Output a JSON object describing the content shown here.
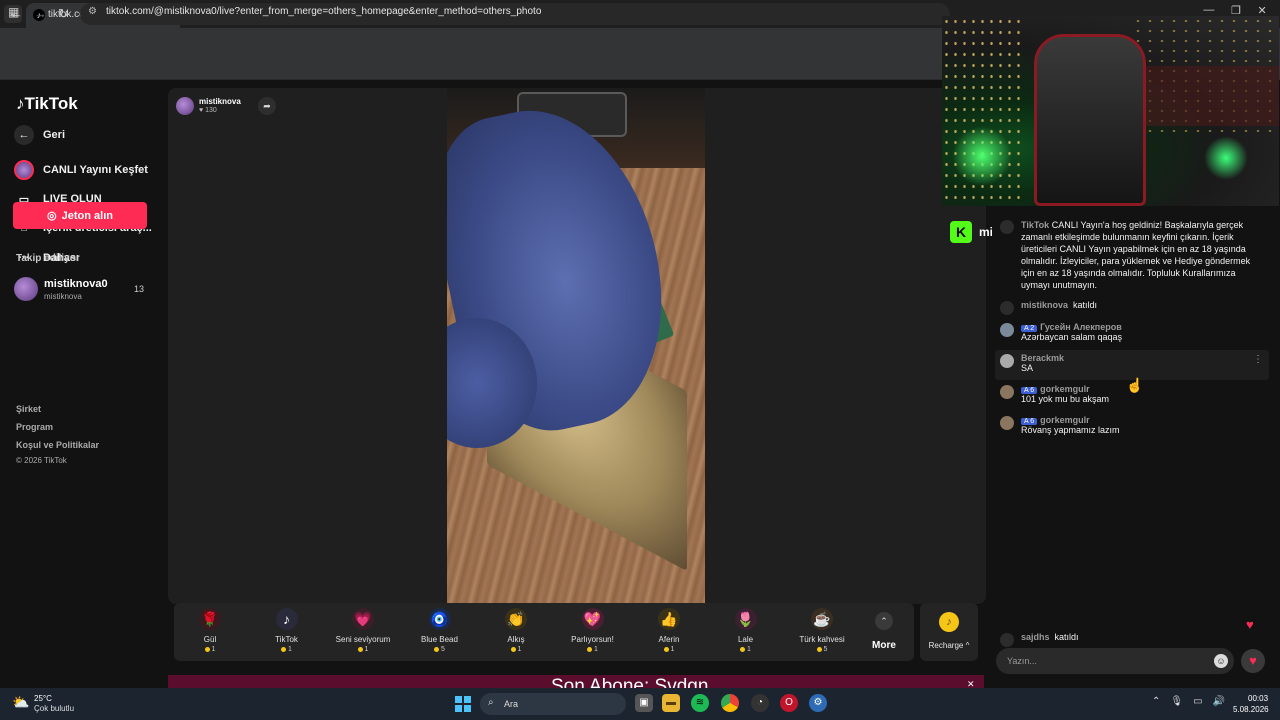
{
  "browser": {
    "tab_title": "tiktok.com/@mistiknova0/li",
    "url": "tiktok.com/@mistiknova0/live?enter_from_merge=others_homepage&enter_method=others_photo"
  },
  "sidebar": {
    "logo": "TikTok",
    "back_label": "Geri",
    "items": [
      {
        "label": "CANLI Yayını Keşfet"
      },
      {
        "label": "LIVE OLUN"
      },
      {
        "label": "İçerik üreticisi araç..."
      },
      {
        "label": "Dahası"
      }
    ],
    "coin_button": "Jeton alın",
    "following_title": "Takip ediliyor",
    "following": {
      "name": "mistiknova0",
      "handle": "mistiknova",
      "count": "13"
    },
    "footer": [
      "Şirket",
      "Program",
      "Koşul ve Politikalar",
      "© 2026 TikTok"
    ]
  },
  "stream": {
    "host_name": "mistiknova",
    "host_likes": "130",
    "kick_name": "mistiknova",
    "banner": "Son Abone: Svdgn"
  },
  "gifts": [
    {
      "name": "Gül",
      "price": "1",
      "icon": "rose-icon",
      "glyph": "🌹"
    },
    {
      "name": "TikTok",
      "price": "1",
      "icon": "tiktok-gift-icon",
      "glyph": "♪"
    },
    {
      "name": "Seni seviyorum",
      "price": "1",
      "icon": "love-icon",
      "glyph": "💗"
    },
    {
      "name": "Blue Bead",
      "price": "5",
      "icon": "blue-bead-icon",
      "glyph": "🧿"
    },
    {
      "name": "Alkış",
      "price": "1",
      "icon": "clap-icon",
      "glyph": "👏"
    },
    {
      "name": "Parlıyorsun!",
      "price": "1",
      "icon": "shine-heart-icon",
      "glyph": "💖"
    },
    {
      "name": "Aferin",
      "price": "1",
      "icon": "thumbs-up-icon",
      "glyph": "👍"
    },
    {
      "name": "Lale",
      "price": "1",
      "icon": "tulip-icon",
      "glyph": "🌷"
    },
    {
      "name": "Türk kahvesi",
      "price": "5",
      "icon": "coffee-icon",
      "glyph": "☕"
    }
  ],
  "gift_more_label": "More",
  "recharge_label": "Recharge ^",
  "chat": {
    "welcome_user": "TikTok",
    "welcome_text": "CANLI Yayın'a hoş geldiniz! Başkalarıyla gerçek zamanlı etkileşimde bulunmanın keyfini çıkarın. İçerik üreticileri CANLI Yayın yapabilmek için en az 18 yaşında olmalıdır. İzleyiciler, para yüklemek ve Hediye göndermek için en az 18 yaşında olmalıdır. Topluluk Kurallarımıza uymayı unutmayın.",
    "join1_user": "mistiknova",
    "join_text": "katıldı",
    "messages": [
      {
        "level": "2",
        "user": "Гусейн Алекперов",
        "text": "Azərbaycan salam qaqaş"
      },
      {
        "level": "",
        "user": "Berackmk",
        "text": "SA"
      },
      {
        "level": "6",
        "user": "gorkemgulr",
        "text": "101 yok mu bu akşam"
      },
      {
        "level": "6",
        "user": "gorkemgulr",
        "text": "Rövanş yapmamız lazım"
      }
    ],
    "join2_user": "sajdhs",
    "input_placeholder": "Yazın..."
  },
  "taskbar": {
    "weather_temp": "25°C",
    "weather_desc": "Çok bulutlu",
    "search_label": "Ara",
    "time": "00:03",
    "date": "5.08.2026"
  },
  "colors": {
    "accent": "#fe2c55",
    "coin": "#f5c518",
    "kick": "#53fc18"
  }
}
